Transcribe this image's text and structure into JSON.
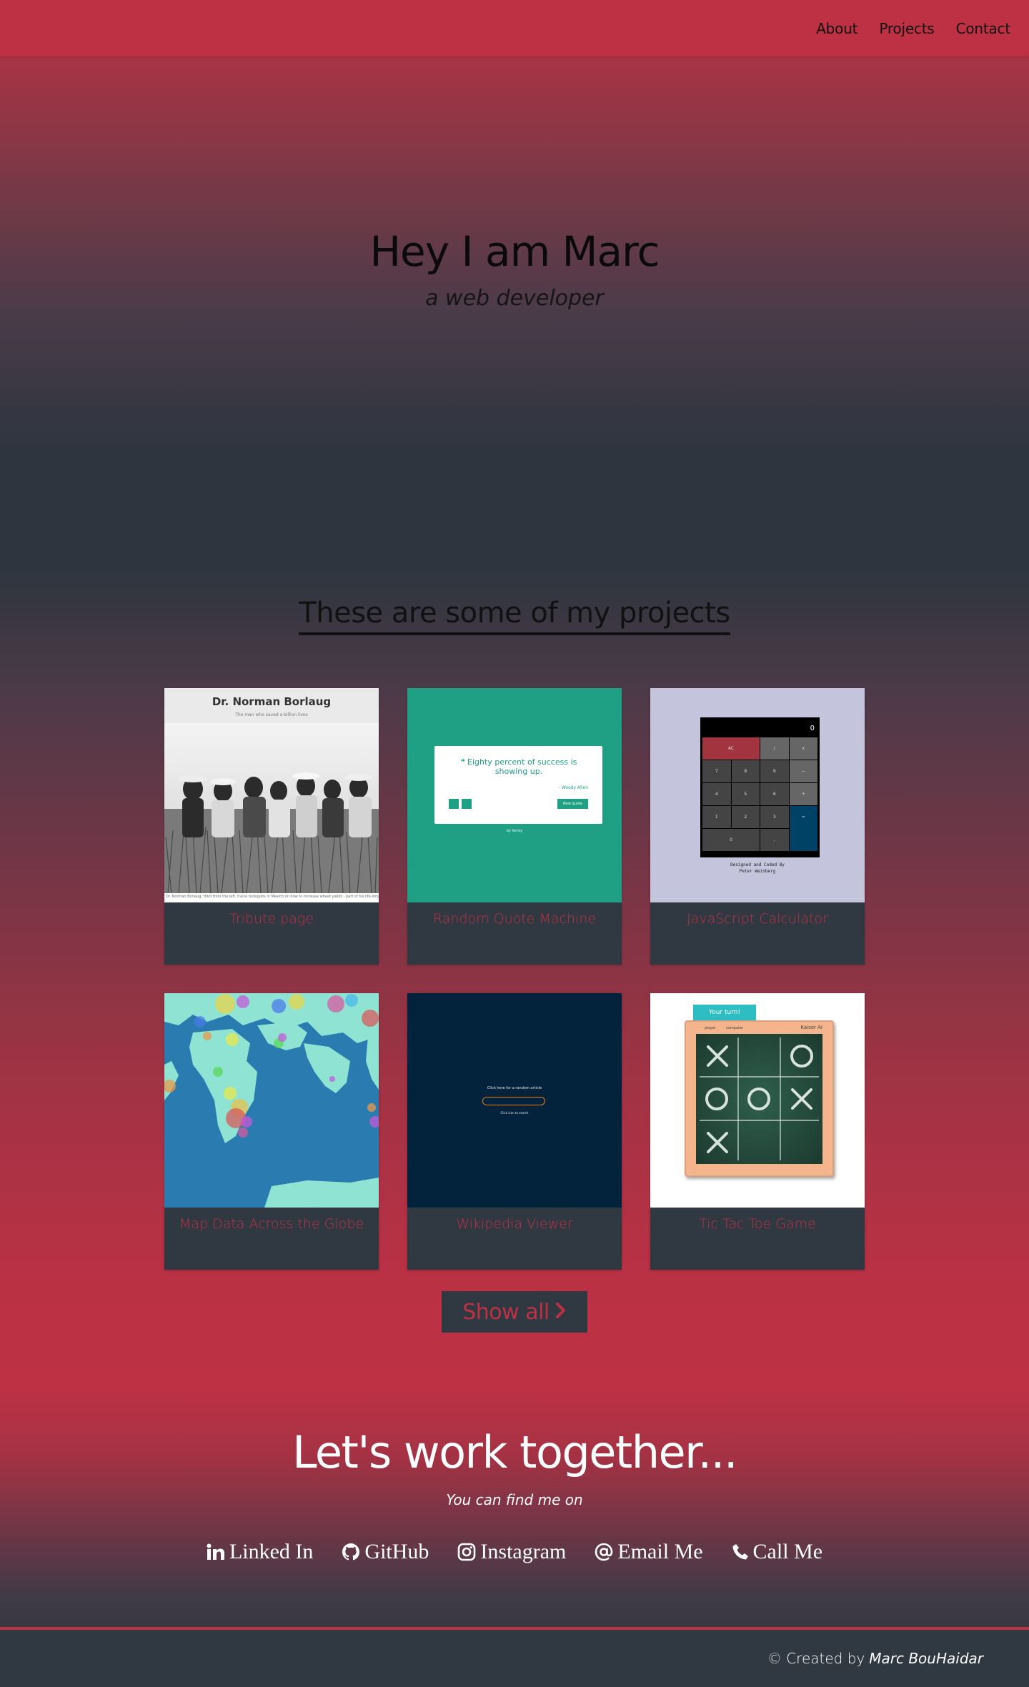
{
  "nav": {
    "links": [
      "About",
      "Projects",
      "Contact"
    ]
  },
  "hero": {
    "title": "Hey I am Marc",
    "subtitle": "a web developer"
  },
  "projects": {
    "header": "These are some of my projects",
    "cards": [
      {
        "label": "Tribute page"
      },
      {
        "label": "Random Quote Machine"
      },
      {
        "label": "JavaScript Calculator"
      },
      {
        "label": "Map Data Across the Globe"
      },
      {
        "label": "Wikipedia Viewer"
      },
      {
        "label": "Tic Tac Toe Game"
      }
    ],
    "show_all": "Show all"
  },
  "thumbs": {
    "tribute": {
      "title": "Dr. Norman Borlaug",
      "subtitle": "The man who saved a billion lives",
      "caption": "Dr. Norman Borlaug, third from the left, trains biologists in Mexico on how to increase wheat yields - part of his life-long war on hunger."
    },
    "quote": {
      "text": "Eighty percent of success is showing up.",
      "author": "- Woody Allen",
      "new_quote": "New quote",
      "by": "by ferrey"
    },
    "calc": {
      "display": "0",
      "keys": [
        "AC",
        "/",
        "x",
        "7",
        "8",
        "9",
        "−",
        "4",
        "5",
        "6",
        "+",
        "1",
        "2",
        "3",
        "=",
        "0",
        "."
      ],
      "credit_line1": "Designed and Coded By",
      "credit_line2": "Peter Weinberg"
    },
    "wiki": {
      "line1": "Click here for a random article",
      "line2": "Click icon to search"
    },
    "ttt": {
      "turn": "Your turn!",
      "player": "player",
      "computer": "computer",
      "ai": "Kaiser AI",
      "cells": [
        "X",
        "",
        "O",
        "O",
        "O",
        "X",
        "X",
        "",
        ""
      ]
    }
  },
  "contact": {
    "title": "Let's work together...",
    "subtitle": "You can find me on",
    "links": [
      "Linked In",
      "GitHub",
      "Instagram",
      "Email Me",
      "Call Me"
    ]
  },
  "footer": {
    "prefix": "© Created by",
    "name": "Marc BouHaidar"
  },
  "colors": {
    "brand_red": "#be3144",
    "dark": "#303841",
    "quote_green": "#1fa085",
    "wiki_navy": "#03233d"
  }
}
